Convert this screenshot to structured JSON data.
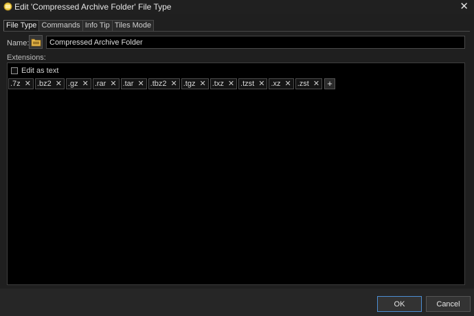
{
  "window": {
    "title": "Edit 'Compressed Archive Folder' File Type",
    "close_glyph": "✕"
  },
  "tabs": [
    {
      "label": "File Type",
      "active": true
    },
    {
      "label": "Commands",
      "active": false
    },
    {
      "label": "Info Tip",
      "active": false
    },
    {
      "label": "Tiles Mode",
      "active": false
    }
  ],
  "name_field": {
    "label": "Name:",
    "value": "Compressed Archive Folder",
    "icon": "folder-icon"
  },
  "extensions": {
    "label": "Extensions:",
    "edit_as_text_label": "Edit as text",
    "edit_as_text_checked": false,
    "items": [
      ".7z",
      ".bz2",
      ".gz",
      ".rar",
      ".tar",
      ".tbz2",
      ".tgz",
      ".txz",
      ".tzst",
      ".xz",
      ".zst"
    ],
    "remove_glyph": "✕",
    "add_glyph": "+"
  },
  "buttons": {
    "ok_label": "OK",
    "cancel_label": "Cancel"
  },
  "colors": {
    "accent": "#4c8fd6",
    "folder_yellow": "#e8b84a"
  }
}
